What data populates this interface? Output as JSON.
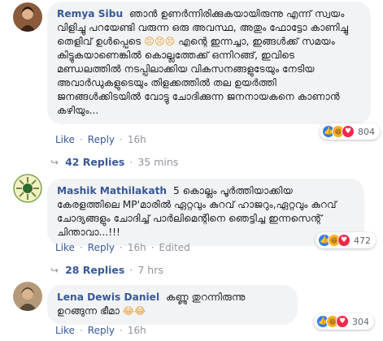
{
  "comments": [
    {
      "name": "Remya Sibu",
      "text": "ഞാൻ ഉണർന്നിരിക്കുകയായിരുന്നു എന്ന് സ്വയം വിളിച്ചു പറയേണ്ടി വരുന്ന ഒരു അവസ്ഥ, അതും ഫോട്ടോ കാണിച്ചു തെളിവ് ഉൾപ്പെടെ",
      "emoji": "😣😣😣",
      "text2": "എന്റെ ഇന്നച്ചാ, ഇങ്ങൾക്ക് സമയം കിട്ടുകയാണെങ്കിൽ കൊല്ലത്തേക്ക് ഒന്നിറങ്ങ്, ഇവിടെ മണ്ഡലത്തിൽ നടപ്പിലാക്കിയ വികസനങ്ങളുടേയും നേടിയ അവാർഡുകളുടെയും തിളക്കത്തിൽ തല ഉയർത്തി ജനങ്ങൾക്കിടയിൽ വോട്ടു ചോദിക്കുന്ന ജനനായകനെ കാണാൻ കഴിയും...",
      "reaction_count": "804",
      "like": "Like",
      "reply": "Reply",
      "time": "16h",
      "replies_label": "42 Replies",
      "replies_time": "35 mins"
    },
    {
      "name": "Mashik Mathilakath",
      "text": "5 കൊല്ലം പൂർത്തിയാക്കിയ കേരളത്തിലെ MP'മാരിൽ ഏറ്റവും കുറവ് ഹാജറും,ഏറ്റവും കുറവ് ചോദ്യങ്ങളും ചോദിച്ച് പാർലിമെന്റിനെ ഞെട്ടിച്ച ഇന്നസെന്റ് ചിന്താവാ...!!!",
      "reaction_count": "472",
      "like": "Like",
      "reply": "Reply",
      "time": "16h",
      "edited": "Edited",
      "replies_label": "28 Replies",
      "replies_time": "7 hrs"
    },
    {
      "name": "Lena Dewis Daniel",
      "text": "കണ്ണു തുറന്നിരുന്നു ഉറങ്ങുന്ന ഭീമാ",
      "emoji": "😂😂",
      "reaction_count": "304",
      "like": "Like",
      "reply": "Reply",
      "time": "16h"
    }
  ],
  "icons": {
    "reply_arrow": "reply-arrow-icon",
    "reactions": [
      "like-reaction-icon",
      "haha-reaction-icon",
      "love-reaction-icon"
    ]
  },
  "colors": {
    "name_link": "#385898",
    "bubble_bg": "#f2f3f5",
    "meta_text": "#90949c"
  }
}
